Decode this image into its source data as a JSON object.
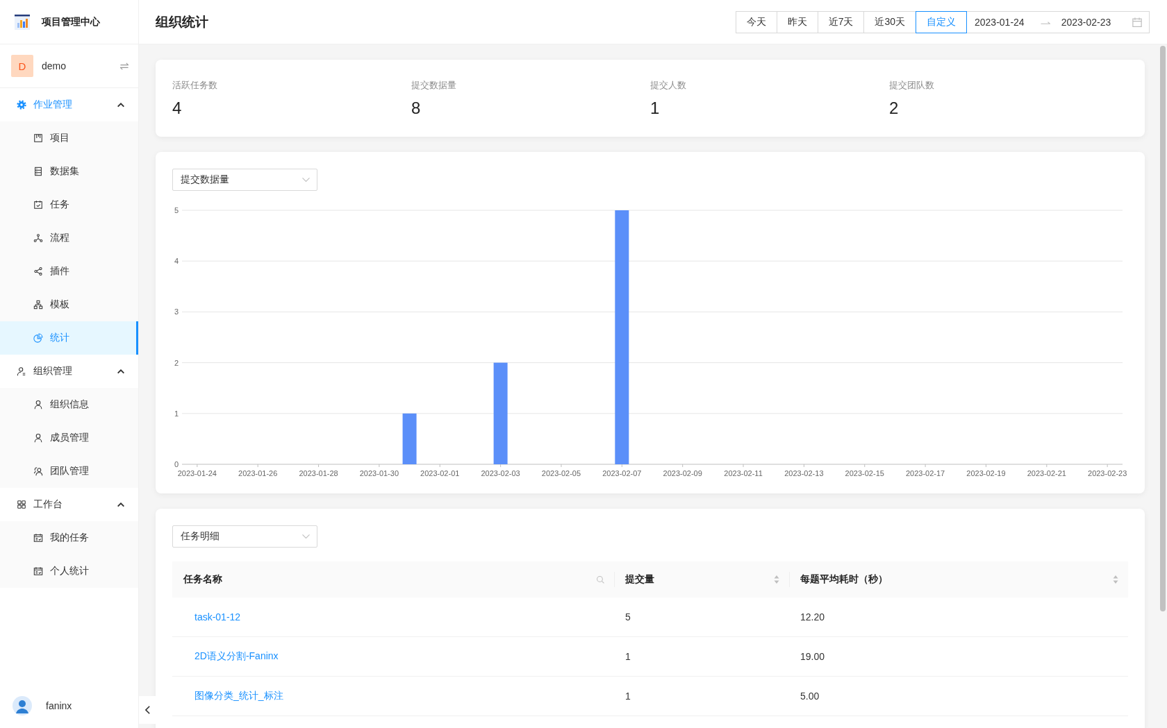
{
  "app": {
    "title": "项目管理中心"
  },
  "workspace": {
    "initial": "D",
    "name": "demo"
  },
  "sidebar": {
    "groups": [
      {
        "label": "作业管理",
        "active": true,
        "expanded": true,
        "items": [
          {
            "label": "项目",
            "selected": false
          },
          {
            "label": "数据集",
            "selected": false
          },
          {
            "label": "任务",
            "selected": false
          },
          {
            "label": "流程",
            "selected": false
          },
          {
            "label": "插件",
            "selected": false
          },
          {
            "label": "模板",
            "selected": false
          },
          {
            "label": "统计",
            "selected": true
          }
        ]
      },
      {
        "label": "组织管理",
        "active": false,
        "expanded": true,
        "items": [
          {
            "label": "组织信息",
            "selected": false
          },
          {
            "label": "成员管理",
            "selected": false
          },
          {
            "label": "团队管理",
            "selected": false
          }
        ]
      },
      {
        "label": "工作台",
        "active": false,
        "expanded": true,
        "items": [
          {
            "label": "我的任务",
            "selected": false
          },
          {
            "label": "个人统计",
            "selected": false
          }
        ]
      }
    ]
  },
  "user": {
    "name": "faninx"
  },
  "header": {
    "title": "组织统计",
    "quick_ranges": [
      {
        "label": "今天",
        "selected": false
      },
      {
        "label": "昨天",
        "selected": false
      },
      {
        "label": "近7天",
        "selected": false
      },
      {
        "label": "近30天",
        "selected": false
      },
      {
        "label": "自定义",
        "selected": true
      }
    ],
    "date_range": {
      "start": "2023-01-24",
      "end": "2023-02-23"
    }
  },
  "summary": [
    {
      "label": "活跃任务数",
      "value": "4"
    },
    {
      "label": "提交数据量",
      "value": "8"
    },
    {
      "label": "提交人数",
      "value": "1"
    },
    {
      "label": "提交团队数",
      "value": "2"
    }
  ],
  "trend": {
    "metric_select": {
      "value": "提交数据量"
    },
    "chart_data": {
      "type": "bar",
      "categories": [
        "2023-01-24",
        null,
        "2023-01-26",
        null,
        "2023-01-28",
        null,
        "2023-01-30",
        null,
        "2023-02-01",
        null,
        "2023-02-03",
        null,
        "2023-02-05",
        null,
        "2023-02-07",
        null,
        "2023-02-09",
        null,
        "2023-02-11",
        null,
        "2023-02-13",
        null,
        "2023-02-15",
        null,
        "2023-02-17",
        null,
        "2023-02-19",
        null,
        "2023-02-21",
        null,
        "2023-02-23"
      ],
      "values": [
        0,
        0,
        0,
        0,
        0,
        0,
        0,
        1,
        0,
        0,
        2,
        0,
        0,
        0,
        5,
        0,
        0,
        0,
        0,
        0,
        0,
        0,
        0,
        0,
        0,
        0,
        0,
        0,
        0,
        0,
        0
      ],
      "ylim": [
        0,
        5
      ],
      "yticks": [
        0,
        1,
        2,
        3,
        4,
        5
      ],
      "grid": true
    }
  },
  "details": {
    "view_select": {
      "value": "任务明细"
    },
    "table": {
      "columns": [
        {
          "label": "任务名称",
          "kind": "search"
        },
        {
          "label": "提交量",
          "kind": "sort"
        },
        {
          "label": "每题平均耗时（秒）",
          "kind": "sort"
        }
      ],
      "rows": [
        {
          "task": "task-01-12",
          "submissions": "5",
          "avg_time": "12.20"
        },
        {
          "task": "2D语义分割-Faninx",
          "submissions": "1",
          "avg_time": "19.00"
        },
        {
          "task": "图像分类_统计_标注",
          "submissions": "1",
          "avg_time": "5.00"
        }
      ]
    }
  }
}
